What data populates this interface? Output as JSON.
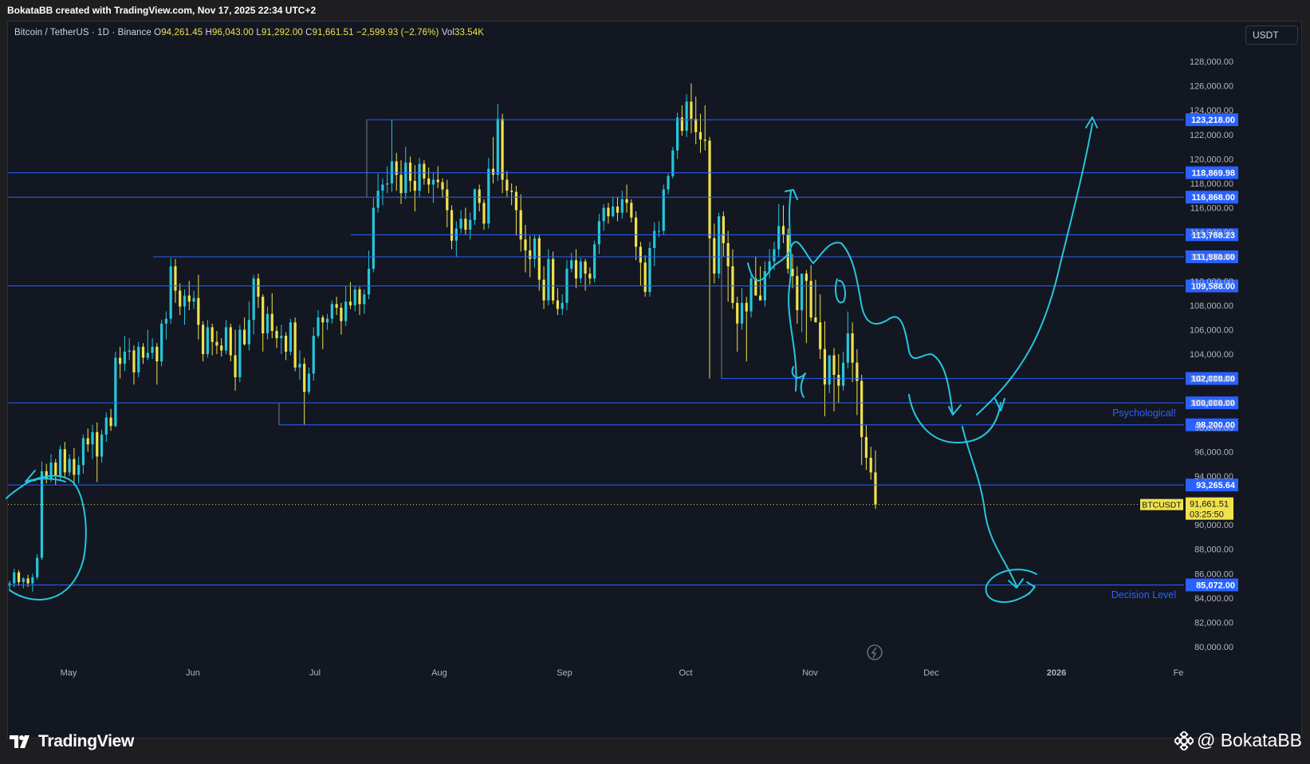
{
  "header": {
    "credit": "BokataBB created with TradingView.com, Nov 17, 2025 22:34 UTC+2"
  },
  "legend": {
    "symbol": "Bitcoin / TetherUS · 1D · Binance",
    "open_label": "O",
    "open": "94,261.45",
    "high_label": "H",
    "high": "96,043.00",
    "low_label": "L",
    "low": "91,292.00",
    "close_label": "C",
    "close": "91,661.51",
    "change": "−2,599.93 (−2.76%)",
    "vol_label": "Vol",
    "vol": "33.54K"
  },
  "currency": "USDT",
  "price_tag": {
    "ticker": "BTCUSDT",
    "price": "91,661.51",
    "countdown": "03:25:50"
  },
  "annotations": {
    "psychological": "Psychological!",
    "decision": "Decision Level"
  },
  "footer": {
    "logo": "TradingView",
    "handle": "@ BokataBB"
  },
  "colors": {
    "background": "#131722",
    "candle": "#f0e24b",
    "level_line": "#2962ff",
    "drawing": "#26c6da",
    "label_text": "#2962ff",
    "axis_text": "#b2b5be"
  },
  "chart_data": {
    "type": "candlestick",
    "symbol": "BTCUSDT",
    "timeframe": "1D",
    "exchange": "Binance",
    "ylim": [
      79000,
      129000
    ],
    "y_ticks": [
      80000,
      82000,
      84000,
      86000,
      88000,
      90000,
      92000,
      94000,
      96000,
      98000,
      100000,
      102000,
      104000,
      106000,
      108000,
      110000,
      112000,
      114000,
      116000,
      118000,
      120000,
      122000,
      124000,
      126000,
      128000
    ],
    "x_ticks": [
      "May",
      "Jun",
      "Jul",
      "Aug",
      "Sep",
      "Oct",
      "Nov",
      "Dec",
      "2026",
      "Fe"
    ],
    "level_labels": [
      "123,218.00",
      "118,869.98",
      "116,868.00",
      "113,788.23",
      "111,980.00",
      "109,588.00",
      "102,000.00",
      "100,000.00",
      "98,200.00",
      "93,265.64",
      "85,072.00"
    ],
    "levels": [
      123218,
      118869.98,
      116868,
      113788.23,
      111980,
      109588,
      102000,
      100000,
      98200,
      93265.64,
      85072
    ],
    "current_price": 91661.51,
    "candles": [
      [
        85000,
        85400,
        84600,
        85200
      ],
      [
        85200,
        86400,
        84900,
        86100
      ],
      [
        86100,
        86300,
        85000,
        85300
      ],
      [
        85300,
        85700,
        84800,
        85600
      ],
      [
        85600,
        85900,
        84900,
        85200
      ],
      [
        85200,
        86000,
        84500,
        85700
      ],
      [
        85700,
        87600,
        85500,
        87300
      ],
      [
        87300,
        95200,
        87100,
        94400
      ],
      [
        94400,
        95000,
        93400,
        93800
      ],
      [
        93800,
        95800,
        93500,
        95100
      ],
      [
        95100,
        95400,
        93300,
        94000
      ],
      [
        94000,
        96500,
        93700,
        96200
      ],
      [
        96200,
        96800,
        93800,
        94300
      ],
      [
        94300,
        95800,
        94000,
        95400
      ],
      [
        95400,
        96300,
        93200,
        94100
      ],
      [
        94100,
        95600,
        93400,
        94900
      ],
      [
        94900,
        97400,
        94200,
        97100
      ],
      [
        97100,
        97900,
        96000,
        96600
      ],
      [
        96600,
        98200,
        95400,
        97600
      ],
      [
        97600,
        98400,
        93500,
        95600
      ],
      [
        95600,
        97800,
        95100,
        97400
      ],
      [
        97400,
        99200,
        96800,
        98800
      ],
      [
        98800,
        99500,
        97700,
        98100
      ],
      [
        98100,
        104200,
        98000,
        103700
      ],
      [
        103700,
        104600,
        102000,
        103200
      ],
      [
        103200,
        105500,
        102600,
        104200
      ],
      [
        104200,
        105300,
        103500,
        104300
      ],
      [
        104300,
        104700,
        101500,
        102500
      ],
      [
        102500,
        105000,
        102100,
        104600
      ],
      [
        104600,
        104900,
        103200,
        103700
      ],
      [
        103700,
        106000,
        103500,
        104100
      ],
      [
        104100,
        105300,
        103600,
        104600
      ],
      [
        104600,
        104900,
        101500,
        103400
      ],
      [
        103400,
        106800,
        103000,
        106500
      ],
      [
        106500,
        107500,
        105200,
        106900
      ],
      [
        106900,
        111900,
        106500,
        111200
      ],
      [
        111200,
        111800,
        108200,
        109200
      ],
      [
        109200,
        109800,
        107200,
        107900
      ],
      [
        107900,
        109300,
        106400,
        108800
      ],
      [
        108800,
        110000,
        107600,
        108300
      ],
      [
        108300,
        109200,
        107700,
        108600
      ],
      [
        108600,
        110500,
        105200,
        106400
      ],
      [
        106400,
        106700,
        103400,
        104000
      ],
      [
        104000,
        106800,
        103700,
        106200
      ],
      [
        106200,
        106500,
        103900,
        105000
      ],
      [
        105000,
        105900,
        104000,
        104700
      ],
      [
        104700,
        105300,
        103800,
        104300
      ],
      [
        104300,
        106800,
        104000,
        106200
      ],
      [
        106200,
        106500,
        103400,
        103900
      ],
      [
        103900,
        106000,
        101000,
        102100
      ],
      [
        102100,
        106400,
        101700,
        106000
      ],
      [
        106000,
        107000,
        104700,
        104800
      ],
      [
        104800,
        108300,
        104300,
        106800
      ],
      [
        106800,
        110500,
        105600,
        110200
      ],
      [
        110200,
        110600,
        107800,
        108700
      ],
      [
        108700,
        108900,
        104200,
        105700
      ],
      [
        105700,
        107900,
        105200,
        107300
      ],
      [
        107300,
        109000,
        105300,
        105900
      ],
      [
        105900,
        106300,
        104500,
        105300
      ],
      [
        105300,
        106400,
        104000,
        105500
      ],
      [
        105500,
        105800,
        103500,
        104200
      ],
      [
        104200,
        106900,
        103900,
        106600
      ],
      [
        106600,
        107000,
        102600,
        102900
      ],
      [
        102900,
        104300,
        101900,
        103200
      ],
      [
        103200,
        103700,
        98200,
        100900
      ],
      [
        100900,
        102900,
        100700,
        102400
      ],
      [
        102400,
        106200,
        101800,
        105500
      ],
      [
        105500,
        107600,
        105300,
        107000
      ],
      [
        107000,
        107200,
        104400,
        106600
      ],
      [
        106600,
        107300,
        106000,
        106900
      ],
      [
        106900,
        108400,
        106500,
        108100
      ],
      [
        108100,
        108700,
        107200,
        107800
      ],
      [
        107800,
        108200,
        105600,
        106700
      ],
      [
        106700,
        109600,
        106300,
        108300
      ],
      [
        108300,
        109900,
        107700,
        108000
      ],
      [
        108000,
        109600,
        107500,
        109300
      ],
      [
        109300,
        109500,
        107200,
        108100
      ],
      [
        108100,
        109300,
        107300,
        108900
      ],
      [
        108900,
        112500,
        108500,
        111000
      ],
      [
        111000,
        116800,
        110700,
        116000
      ],
      [
        116000,
        118800,
        115600,
        117400
      ],
      [
        117400,
        118400,
        116200,
        117900
      ],
      [
        117900,
        119400,
        117200,
        118000
      ],
      [
        118000,
        123200,
        117300,
        119800
      ],
      [
        119800,
        120500,
        117400,
        118700
      ],
      [
        118700,
        119900,
        116300,
        117200
      ],
      [
        117200,
        121000,
        116700,
        119700
      ],
      [
        119700,
        120200,
        117300,
        118200
      ],
      [
        118200,
        119500,
        115700,
        117400
      ],
      [
        117400,
        120100,
        116900,
        119600
      ],
      [
        119600,
        119900,
        117900,
        118400
      ],
      [
        118400,
        119300,
        117200,
        117900
      ],
      [
        117900,
        118900,
        116400,
        118300
      ],
      [
        118300,
        119400,
        117600,
        118100
      ],
      [
        118100,
        118400,
        116800,
        117500
      ],
      [
        117500,
        118300,
        114400,
        115800
      ],
      [
        115800,
        116200,
        112600,
        113300
      ],
      [
        113300,
        114900,
        112000,
        114300
      ],
      [
        114300,
        115800,
        113900,
        115100
      ],
      [
        115100,
        116000,
        113800,
        114200
      ],
      [
        114200,
        115600,
        113400,
        115000
      ],
      [
        115000,
        117600,
        114600,
        117500
      ],
      [
        117500,
        117900,
        115700,
        116400
      ],
      [
        116400,
        116700,
        114200,
        114700
      ],
      [
        114700,
        120100,
        114300,
        119200
      ],
      [
        119200,
        121800,
        118000,
        118700
      ],
      [
        118700,
        124500,
        118200,
        123300
      ],
      [
        123300,
        123700,
        117200,
        118300
      ],
      [
        118300,
        119000,
        116900,
        117400
      ],
      [
        117400,
        118000,
        116200,
        117300
      ],
      [
        117300,
        117800,
        113700,
        115800
      ],
      [
        115800,
        117100,
        112400,
        113400
      ],
      [
        113400,
        114600,
        110700,
        112500
      ],
      [
        112500,
        113700,
        110300,
        111800
      ],
      [
        111800,
        113800,
        111100,
        113500
      ],
      [
        113500,
        113800,
        109200,
        110100
      ],
      [
        110100,
        111200,
        107700,
        108400
      ],
      [
        108400,
        112600,
        108000,
        111800
      ],
      [
        111800,
        112400,
        108100,
        108400
      ],
      [
        108400,
        109400,
        107200,
        107700
      ],
      [
        107700,
        108900,
        107200,
        108200
      ],
      [
        108200,
        111700,
        107600,
        111000
      ],
      [
        111000,
        112300,
        110700,
        111700
      ],
      [
        111700,
        112600,
        109400,
        110200
      ],
      [
        110200,
        111900,
        109800,
        111600
      ],
      [
        111600,
        111800,
        109200,
        110600
      ],
      [
        110600,
        111100,
        109700,
        110200
      ],
      [
        110200,
        113300,
        109900,
        113000
      ],
      [
        113000,
        115500,
        112200,
        114900
      ],
      [
        114900,
        116300,
        114100,
        116000
      ],
      [
        116000,
        116400,
        114700,
        115300
      ],
      [
        115300,
        116900,
        115200,
        116100
      ],
      [
        116100,
        116900,
        114900,
        115600
      ],
      [
        115600,
        117400,
        115100,
        116700
      ],
      [
        116700,
        117900,
        115600,
        116400
      ],
      [
        116400,
        116700,
        114800,
        115200
      ],
      [
        115200,
        115700,
        111700,
        112800
      ],
      [
        112800,
        113200,
        109600,
        111500
      ],
      [
        111500,
        112100,
        108700,
        109100
      ],
      [
        109100,
        113200,
        108700,
        112700
      ],
      [
        112700,
        114800,
        111200,
        114100
      ],
      [
        114100,
        114900,
        113600,
        114100
      ],
      [
        114100,
        117900,
        113800,
        117500
      ],
      [
        117500,
        118800,
        117100,
        118600
      ],
      [
        118600,
        121000,
        118400,
        120700
      ],
      [
        120700,
        123800,
        120000,
        123400
      ],
      [
        123400,
        124400,
        121900,
        122300
      ],
      [
        122300,
        125300,
        121800,
        124700
      ],
      [
        124700,
        126200,
        122100,
        123300
      ],
      [
        123300,
        125100,
        121200,
        122200
      ],
      [
        122200,
        123700,
        120500,
        121600
      ],
      [
        121600,
        124400,
        120700,
        121500
      ],
      [
        121500,
        121800,
        102000,
        113500
      ],
      [
        113500,
        114700,
        109800,
        110600
      ],
      [
        110600,
        115600,
        110200,
        115300
      ],
      [
        115300,
        115700,
        112000,
        113100
      ],
      [
        113100,
        114100,
        108300,
        111200
      ],
      [
        111200,
        112600,
        107700,
        108200
      ],
      [
        108200,
        108700,
        104200,
        106500
      ],
      [
        106500,
        109400,
        106000,
        108200
      ],
      [
        108200,
        108700,
        103400,
        107500
      ],
      [
        107500,
        110500,
        107000,
        110200
      ],
      [
        110200,
        112000,
        109600,
        108800
      ],
      [
        108800,
        111200,
        108500,
        108400
      ],
      [
        108400,
        111600,
        107900,
        110800
      ],
      [
        110800,
        112600,
        110200,
        111600
      ],
      [
        111600,
        113200,
        110900,
        112600
      ],
      [
        112600,
        116300,
        112000,
        114500
      ],
      [
        114500,
        116200,
        113100,
        113800
      ],
      [
        113800,
        114300,
        110600,
        111000
      ],
      [
        111000,
        112200,
        109400,
        110400
      ],
      [
        110400,
        111200,
        106500,
        107600
      ],
      [
        107600,
        108800,
        105800,
        110600
      ],
      [
        110600,
        110900,
        104900,
        110000
      ],
      [
        110000,
        111300,
        106700,
        107000
      ],
      [
        107000,
        110100,
        106800,
        106600
      ],
      [
        106600,
        108900,
        103600,
        104400
      ],
      [
        104400,
        106700,
        98900,
        101500
      ],
      [
        101500,
        103500,
        100800,
        103900
      ],
      [
        103900,
        104500,
        99300,
        102300
      ],
      [
        102300,
        104000,
        100000,
        101400
      ],
      [
        101400,
        104200,
        101000,
        103300
      ],
      [
        103300,
        107500,
        102800,
        105700
      ],
      [
        105700,
        106600,
        101700,
        103300
      ],
      [
        103300,
        104400,
        99000,
        101800
      ],
      [
        101800,
        102300,
        94900,
        97200
      ],
      [
        97200,
        98200,
        94500,
        95500
      ],
      [
        95500,
        96400,
        93700,
        94300
      ],
      [
        94300,
        96100,
        91300,
        91660
      ]
    ]
  }
}
